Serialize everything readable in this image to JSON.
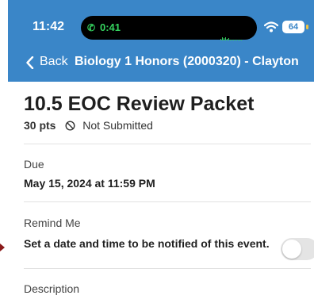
{
  "status_bar": {
    "time": "11:42",
    "call_timer": "0:41",
    "battery_level": "64",
    "icons": [
      "phone-icon",
      "wifi-icon",
      "battery-icon"
    ]
  },
  "nav": {
    "back_label": "Back",
    "course_title": "Biology 1 Honors (2000320) - Clayton"
  },
  "assignment": {
    "title": "10.5 EOC Review Packet",
    "points": "30 pts",
    "submission_status": "Not Submitted"
  },
  "due": {
    "label": "Due",
    "value": "May 15, 2024 at 11:59 PM"
  },
  "remind": {
    "label": "Remind Me",
    "text": "Set a date and time to be notified of this event.",
    "enabled": false
  },
  "description": {
    "label": "Description"
  },
  "colors": {
    "header": "#3a86c8",
    "call_green": "#35d35f",
    "toggle_off": "#e4e4e4"
  }
}
